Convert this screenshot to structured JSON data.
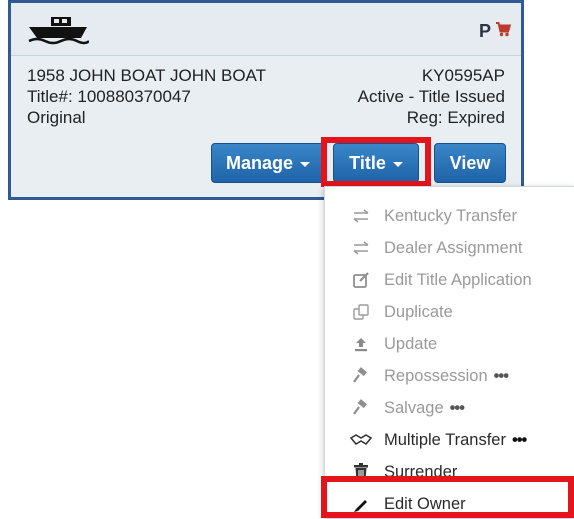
{
  "vehicle": {
    "description": "1958 JOHN BOAT JOHN BOAT",
    "title_number": "Title#: 100880370047",
    "title_type": "Original",
    "registration_number": "KY0595AP",
    "status": "Active - Title Issued",
    "registration_status": "Reg: Expired",
    "flag": "P"
  },
  "buttons": {
    "manage": "Manage",
    "title": "Title",
    "view": "View"
  },
  "title_menu": {
    "items": [
      {
        "label": "Kentucky Transfer",
        "icon": "transfer-icon",
        "enabled": false,
        "more": ""
      },
      {
        "label": "Dealer Assignment",
        "icon": "transfer-icon",
        "enabled": false,
        "more": ""
      },
      {
        "label": "Edit Title Application",
        "icon": "edit-square-icon",
        "enabled": false,
        "more": ""
      },
      {
        "label": "Duplicate",
        "icon": "duplicate-icon",
        "enabled": false,
        "more": ""
      },
      {
        "label": "Update",
        "icon": "upload-icon",
        "enabled": false,
        "more": ""
      },
      {
        "label": "Repossession",
        "icon": "gavel-icon",
        "enabled": false,
        "more": "•••"
      },
      {
        "label": "Salvage",
        "icon": "gavel-icon",
        "enabled": false,
        "more": "•••"
      },
      {
        "label": "Multiple Transfer",
        "icon": "handshake-icon",
        "enabled": true,
        "more": "•••"
      },
      {
        "label": "Surrender",
        "icon": "trash-icon",
        "enabled": true,
        "more": ""
      },
      {
        "label": "Edit Owner",
        "icon": "pencil-icon",
        "enabled": true,
        "more": ""
      }
    ]
  },
  "colors": {
    "accent_button": "#2a72b8",
    "highlight_red": "#e3141b",
    "card_border": "#2f5a94",
    "cart_red": "#c0392b"
  }
}
